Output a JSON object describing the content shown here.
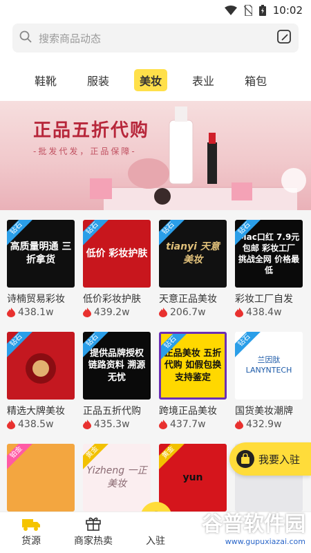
{
  "status_bar": {
    "time": "10:02"
  },
  "search": {
    "placeholder": "搜索商品动态"
  },
  "tabs": [
    {
      "label": "鞋靴"
    },
    {
      "label": "服装"
    },
    {
      "label": "美妆"
    },
    {
      "label": "表业"
    },
    {
      "label": "箱包"
    }
  ],
  "banner": {
    "title": "正品五折代购",
    "subtitle": "-批发代发，正品保障-"
  },
  "badges": {
    "blue": "钻石",
    "pink": "铂金",
    "yellow": "黄金"
  },
  "products_row1": [
    {
      "name": "诗楠贸易彩妆",
      "heat": "438.1w",
      "thumb_text": "高质量明通 三折拿货"
    },
    {
      "name": "低价彩妆护肤",
      "heat": "439.2w",
      "thumb_text": "低价 彩妆护肤"
    },
    {
      "name": "天意正品美妆",
      "heat": "206.7w",
      "thumb_text": "tianyi 天意美妆"
    },
    {
      "name": "彩妆工厂自发",
      "heat": "438.4w",
      "thumb_text": "Mac口红 7.9元包邮 彩妆工厂 挑战全网 价格最低"
    }
  ],
  "products_row2": [
    {
      "name": "精选大牌美妆",
      "heat": "438.5w",
      "thumb_text": ""
    },
    {
      "name": "正品五折代购",
      "heat": "435.3w",
      "thumb_text": "提供品牌授权 链路资料 溯源无忧"
    },
    {
      "name": "跨境正品美妆",
      "heat": "437.7w",
      "thumb_text": "正品美妆 五折代购 如假包换 支持鉴定"
    },
    {
      "name": "国货美妆潮牌",
      "heat": "432.9w",
      "thumb_text": "兰因肽 LANYNTECH"
    }
  ],
  "products_row3": [
    {
      "thumb_text": ""
    },
    {
      "thumb_text": "Yizheng 一正美妆"
    },
    {
      "thumb_text": "yun"
    },
    {
      "thumb_text": ""
    }
  ],
  "join_button": {
    "label": "我要入驻"
  },
  "bottom_nav": [
    {
      "label": "货源"
    },
    {
      "label": "商家热卖"
    },
    {
      "label": "入驻"
    }
  ],
  "watermark": {
    "main": "谷普软件园",
    "url": "www.gupuxiazai.com"
  },
  "colors": {
    "accent": "#ffdc3a",
    "flame": "#e8312f",
    "badge_blue": "#2a9ee8"
  }
}
